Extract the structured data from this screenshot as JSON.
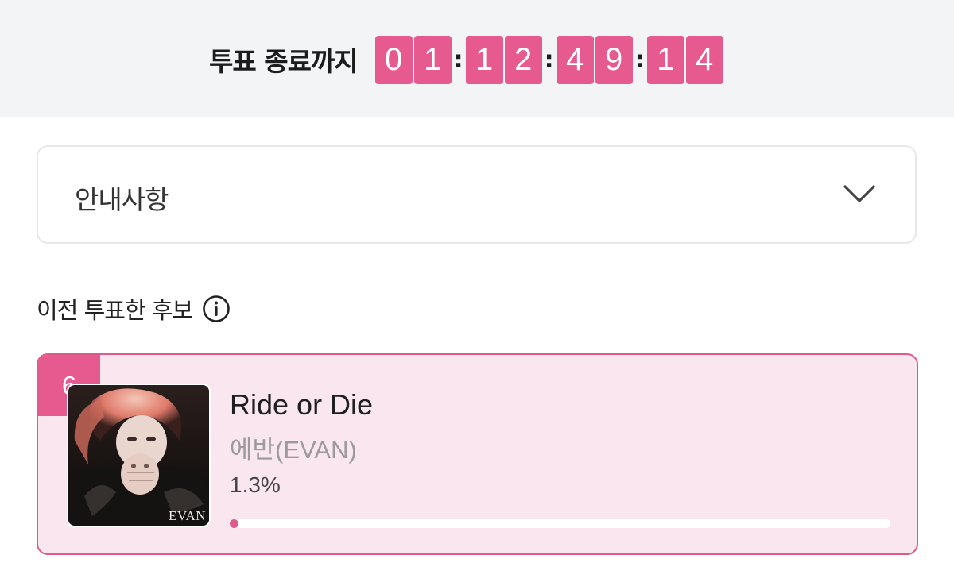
{
  "timer": {
    "label": "투표 종료까지",
    "digits": [
      "0",
      "1",
      "1",
      "2",
      "4",
      "9",
      "1",
      "4"
    ],
    "separator": ":",
    "accent_color": "#e75a8f"
  },
  "notice": {
    "label": "안내사항",
    "icon": "chevron-down-icon"
  },
  "previous": {
    "heading": "이전 투표한 후보",
    "info_icon": "info-icon"
  },
  "candidate": {
    "rank": "6",
    "title": "Ride or Die",
    "artist": "에반(EVAN)",
    "percent_label": "1.3%",
    "percent_value": 0.013,
    "album_text": "EVAN",
    "accent_color": "#e0598d",
    "card_bg": "#f9e6ee"
  }
}
